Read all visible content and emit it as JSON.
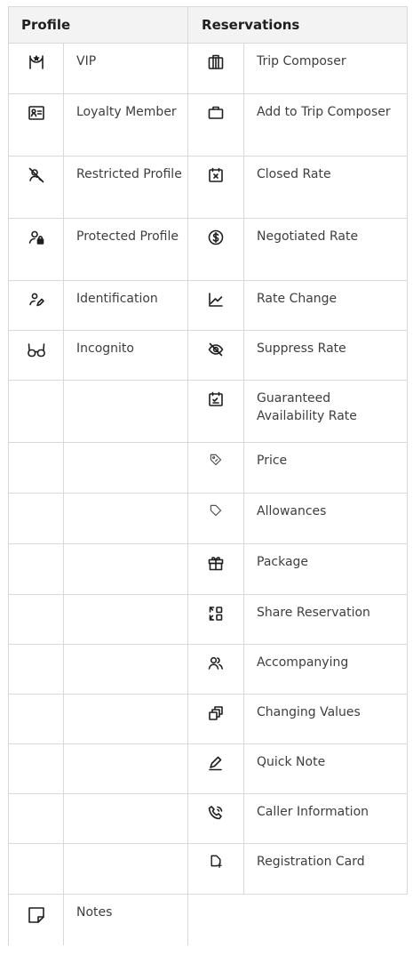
{
  "headers": {
    "profile": "Profile",
    "reservations": "Reservations"
  },
  "profile_items": [
    {
      "label": "VIP",
      "icon": "vip-icon"
    },
    {
      "label": "Loyalty Member",
      "icon": "id-card-icon"
    },
    {
      "label": "Restricted Profile",
      "icon": "restricted-user-icon"
    },
    {
      "label": "Protected Profile",
      "icon": "protected-user-icon"
    },
    {
      "label": "Identification",
      "icon": "identification-icon"
    },
    {
      "label": "Incognito",
      "icon": "glasses-icon"
    }
  ],
  "reservation_items": [
    {
      "label": "Trip Composer",
      "icon": "luggage-icon"
    },
    {
      "label": "Add to Trip Composer",
      "icon": "briefcase-icon"
    },
    {
      "label": "Closed Rate",
      "icon": "calendar-closed-icon"
    },
    {
      "label": "Negotiated Rate",
      "icon": "dollar-circle-icon"
    },
    {
      "label": "Rate Change",
      "icon": "line-chart-icon"
    },
    {
      "label": "Suppress Rate",
      "icon": "eye-off-icon"
    },
    {
      "label": "Guaranteed Availability Rate",
      "icon": "calendar-check-icon"
    },
    {
      "label": "Price",
      "icon": "price-tag-icon"
    },
    {
      "label": "Allowances",
      "icon": "tag-icon"
    },
    {
      "label": "Package",
      "icon": "gift-icon"
    },
    {
      "label": "Share Reservation",
      "icon": "share-reservation-icon"
    },
    {
      "label": "Accompanying",
      "icon": "people-icon"
    },
    {
      "label": "Changing Values",
      "icon": "changing-values-icon"
    },
    {
      "label": "Quick Note",
      "icon": "pen-icon"
    },
    {
      "label": "Caller Information",
      "icon": "phone-icon"
    },
    {
      "label": "Registration Card",
      "icon": "registration-card-icon"
    }
  ],
  "footer_item": {
    "label": "Notes",
    "icon": "sticky-note-icon"
  }
}
